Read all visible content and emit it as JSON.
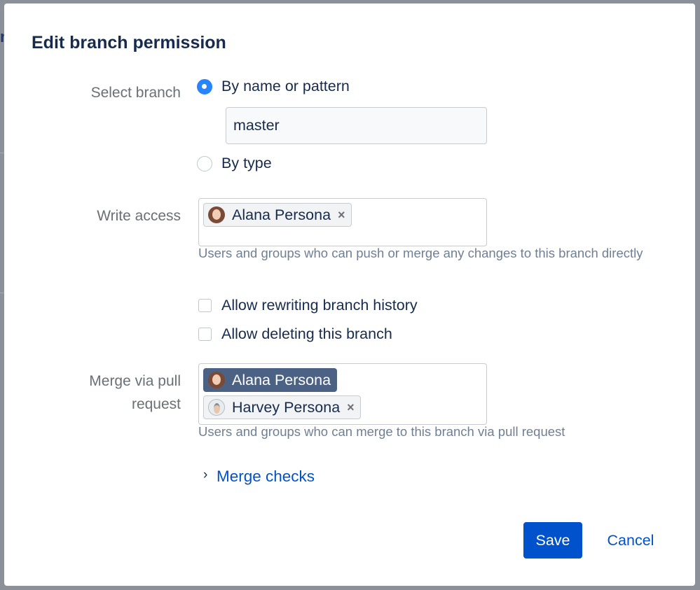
{
  "dialog": {
    "title": "Edit branch permission",
    "select_branch": {
      "label": "Select branch",
      "option_name": "By name or pattern",
      "option_type": "By type",
      "selected": "By name or pattern",
      "pattern_value": "master"
    },
    "write_access": {
      "label": "Write access",
      "users": [
        {
          "name": "Alana Persona",
          "avatar": "alana-avatar-icon",
          "remove_icon": "×"
        }
      ],
      "help": "Users and groups who can push or merge any changes to this branch directly"
    },
    "options": {
      "allow_rewriting": "Allow rewriting branch history",
      "allow_deleting": "Allow deleting this branch"
    },
    "merge_pr": {
      "label": "Merge via pull request",
      "users": [
        {
          "name": "Alana Persona",
          "avatar": "alana-avatar-icon",
          "selected": true
        },
        {
          "name": "Harvey Persona",
          "avatar": "harvey-avatar-icon",
          "remove_icon": "×"
        }
      ],
      "help": "Users and groups who can merge to this branch via pull request"
    },
    "merge_checks": {
      "chevron": "›",
      "label": "Merge checks"
    },
    "actions": {
      "save": "Save",
      "cancel": "Cancel"
    }
  },
  "colors": {
    "primary": "#0052cc",
    "radio_checked": "#2684ff",
    "selected_chip": "#4c6285"
  }
}
